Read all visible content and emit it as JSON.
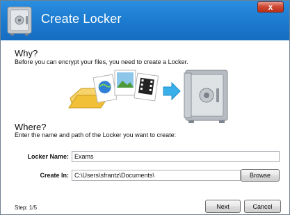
{
  "window": {
    "title": "Create Locker",
    "close_glyph": "x"
  },
  "why": {
    "heading": "Why?",
    "description": "Before you can encrypt your files, you need to create a Locker."
  },
  "illustration": {
    "icons": [
      "folder-icon",
      "globe-document-icon",
      "image-document-icon",
      "film-document-icon",
      "arrow-right-icon",
      "safe-icon"
    ]
  },
  "where": {
    "heading": "Where?",
    "description": "Enter the name and path of the Locker you want to create:"
  },
  "form": {
    "locker_name_label": "Locker Name:",
    "locker_name_value": "Exams",
    "create_in_label": "Create In:",
    "create_in_value": "C:\\Users\\sfrantz\\Documents\\",
    "browse_label": "Browse"
  },
  "footer": {
    "step_text": "Step: 1/5",
    "next_label": "Next",
    "cancel_label": "Cancel"
  },
  "colors": {
    "titlebar": "#1f7fd3",
    "arrow": "#39b0ea",
    "folder": "#f2c037"
  }
}
